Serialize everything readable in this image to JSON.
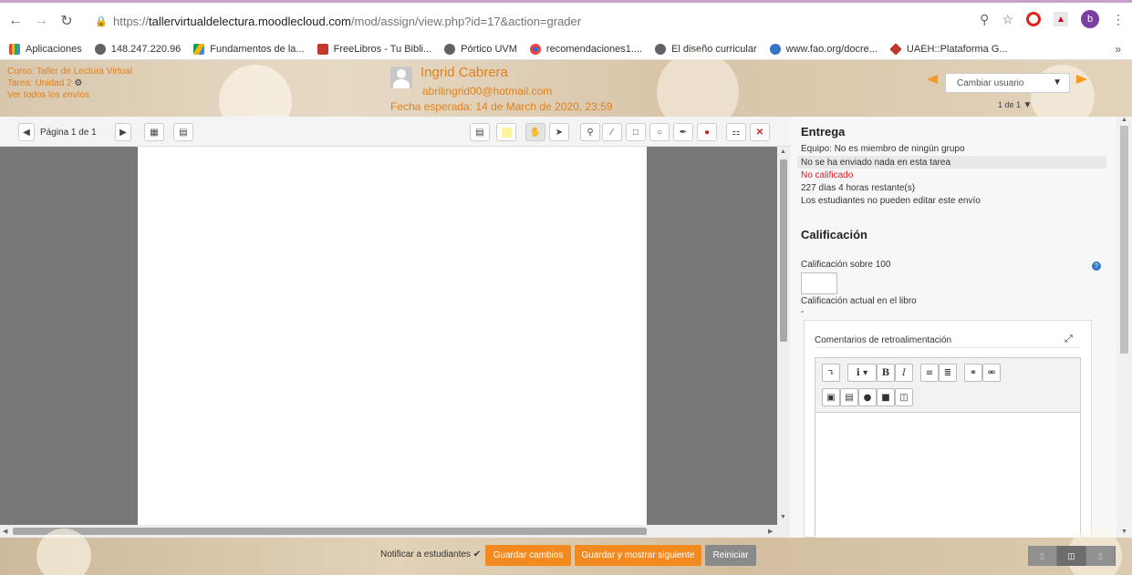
{
  "browser": {
    "url_scheme": "https://",
    "url_host": "tallervirtualdelectura.moodlecloud.com",
    "url_path": "/mod/assign/view.php?id=17&action=grader",
    "profile_initial": "b"
  },
  "bookmarks": {
    "items": [
      {
        "label": "Aplicaciones",
        "icon": "apps-grid-icon",
        "color": "#4285f4"
      },
      {
        "label": "148.247.220.96",
        "icon": "globe-icon",
        "color": "#5f6368"
      },
      {
        "label": "Fundamentos de la...",
        "icon": "drive-icon",
        "color": "#f4b400"
      },
      {
        "label": "FreeLibros - Tu Bibli...",
        "icon": "book-icon",
        "color": "#c0392b"
      },
      {
        "label": "Pórtico UVM",
        "icon": "globe-icon",
        "color": "#5f6368"
      },
      {
        "label": "recomendaciones1....",
        "icon": "eye-icon",
        "color": "#1a73e8"
      },
      {
        "label": "El diseño curricular",
        "icon": "globe-icon",
        "color": "#5f6368"
      },
      {
        "label": "www.fao.org/docre...",
        "icon": "fao-icon",
        "color": "#3a74c9"
      },
      {
        "label": "UAEH::Plataforma G...",
        "icon": "uaeh-icon",
        "color": "#c0392b"
      }
    ],
    "more": "»"
  },
  "header": {
    "course": "Curso: Taller de Lectura Virtual",
    "task": "Tarea: Unidad 2",
    "view_all": "Ver todos los envíos",
    "user_name": "Ingrid Cabrera",
    "user_email": "abrilingrid00@hotmail.com",
    "due_date": "Fecha esperada: 14 de March de 2020, 23:59",
    "change_user": "Cambiar usuario",
    "user_count": "1 de 1",
    "accent": "#e0811b"
  },
  "pdf_toolbar": {
    "page_label": "Página 1 de 1"
  },
  "submission": {
    "heading": "Entrega",
    "team": "Equipo:    No es miembro de ningún grupo",
    "status": "No se ha enviado nada en esta tarea",
    "grade_status": "No calificado",
    "time_left": "227 días 4 horas restante(s)",
    "edit_note": "Los estudiantes no pueden editar este envío"
  },
  "grading": {
    "heading": "Calificación",
    "grade_label": "Calificación sobre 100",
    "grade_value": "",
    "gradebook_label": "Calificación actual en el libro",
    "gradebook_value": "-",
    "feedback_label": "Comentarios de retroalimentación"
  },
  "footer": {
    "notify_label": "Notificar a estudiantes",
    "save_label": "Guardar cambios",
    "save_next_label": "Guardar y mostrar siguiente",
    "reset_label": "Reiniciar"
  }
}
